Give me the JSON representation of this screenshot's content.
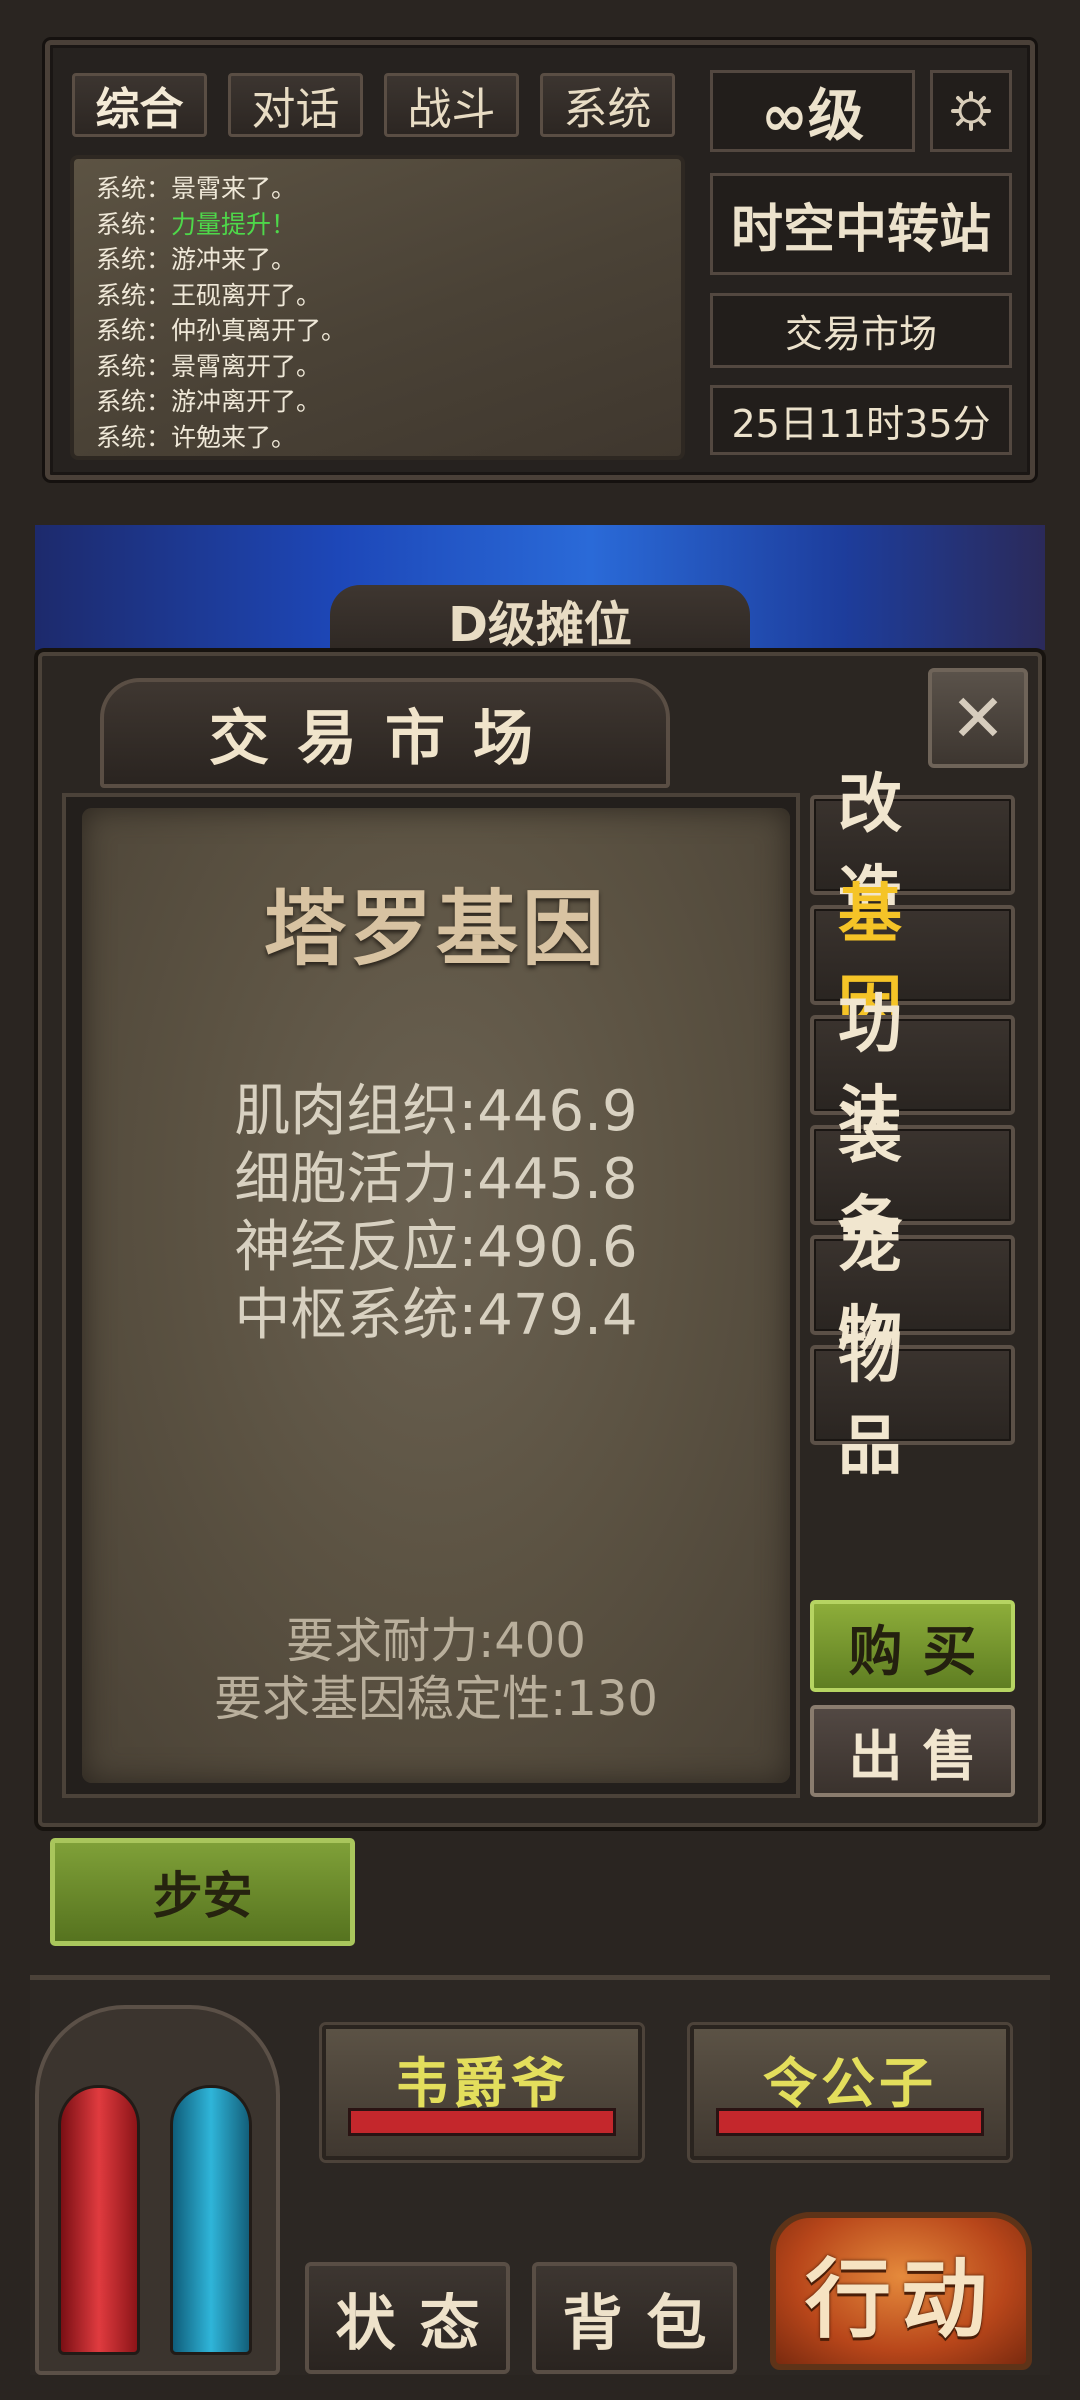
{
  "chat_tabs": [
    "综合",
    "对话",
    "战斗",
    "系统"
  ],
  "level_label": "∞级",
  "settings_icon": "gear-icon",
  "chat_log": [
    {
      "prefix": "系统：",
      "text": "景霄来了。",
      "highlight": false
    },
    {
      "prefix": "系统：",
      "text": "力量提升！",
      "highlight": true
    },
    {
      "prefix": "系统：",
      "text": "游冲来了。",
      "highlight": false
    },
    {
      "prefix": "系统：",
      "text": "王砚离开了。",
      "highlight": false
    },
    {
      "prefix": "系统：",
      "text": "仲孙真离开了。",
      "highlight": false
    },
    {
      "prefix": "系统：",
      "text": "景霄离开了。",
      "highlight": false
    },
    {
      "prefix": "系统：",
      "text": "游冲离开了。",
      "highlight": false
    },
    {
      "prefix": "系统：",
      "text": "许勉来了。",
      "highlight": false
    }
  ],
  "location": {
    "station": "时空中转站",
    "area": "交易市场",
    "time": "25日11时35分"
  },
  "banner_title": "D级摊位",
  "market": {
    "title": "交易市场",
    "close_icon": "close-icon",
    "item_name": "塔罗基因",
    "stats": [
      "肌肉组织:446.9",
      "细胞活力:445.8",
      "神经反应:490.6",
      "中枢系统:479.4"
    ],
    "requirements": [
      "要求耐力:400",
      "要求基因稳定性:130"
    ],
    "categories": [
      {
        "label": "改造",
        "selected": false
      },
      {
        "label": "基因",
        "selected": true
      },
      {
        "label": "功法",
        "selected": false
      },
      {
        "label": "装备",
        "selected": false
      },
      {
        "label": "宠物",
        "selected": false
      },
      {
        "label": "物品",
        "selected": false
      }
    ],
    "buy_label": "购买",
    "sell_label": "出售"
  },
  "nearby_player": "步安",
  "targets": [
    "韦爵爷",
    "令公子"
  ],
  "bottom_menu": {
    "status_label": "状态",
    "bag_label": "背包",
    "action_label": "行动"
  },
  "colors": {
    "accent_gold": "#f5c427",
    "chat_highlight": "#4ed84a",
    "buy_green": "#7fa038",
    "hp_red": "#c4272c",
    "mp_blue": "#2fb5d9"
  }
}
